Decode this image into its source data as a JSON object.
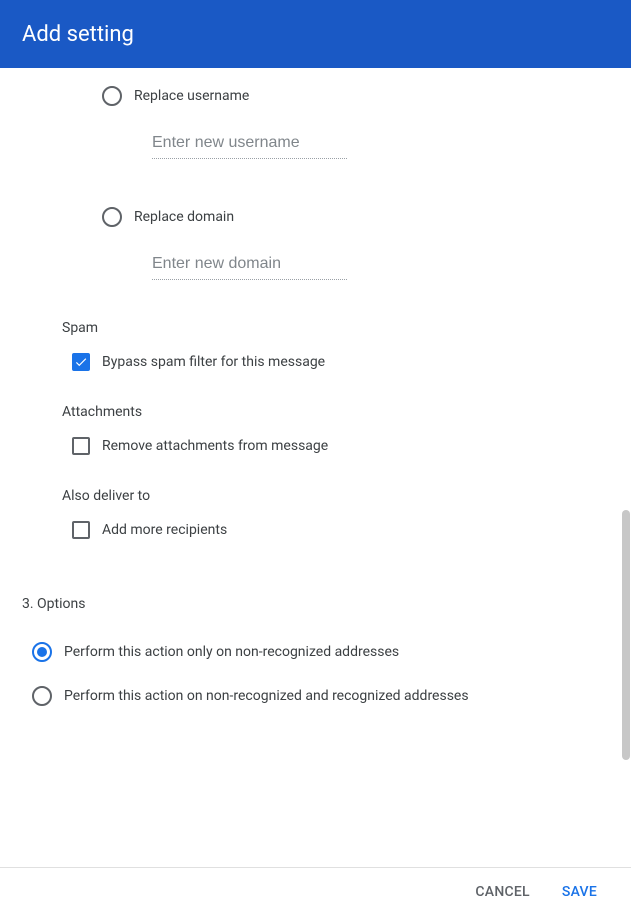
{
  "header": {
    "title": "Add setting"
  },
  "replace": {
    "username_label": "Replace username",
    "username_placeholder": "Enter new username",
    "domain_label": "Replace domain",
    "domain_placeholder": "Enter new domain"
  },
  "spam": {
    "section": "Spam",
    "bypass_label": "Bypass spam filter for this message",
    "bypass_checked": true
  },
  "attachments": {
    "section": "Attachments",
    "remove_label": "Remove attachments from message",
    "remove_checked": false
  },
  "deliver": {
    "section": "Also deliver to",
    "add_more_label": "Add more recipients",
    "add_more_checked": false
  },
  "options": {
    "header": "3. Options",
    "opt1_label": "Perform this action only on non-recognized addresses",
    "opt2_label": "Perform this action on non-recognized and recognized addresses",
    "selected": 1
  },
  "footer": {
    "cancel": "CANCEL",
    "save": "SAVE"
  }
}
